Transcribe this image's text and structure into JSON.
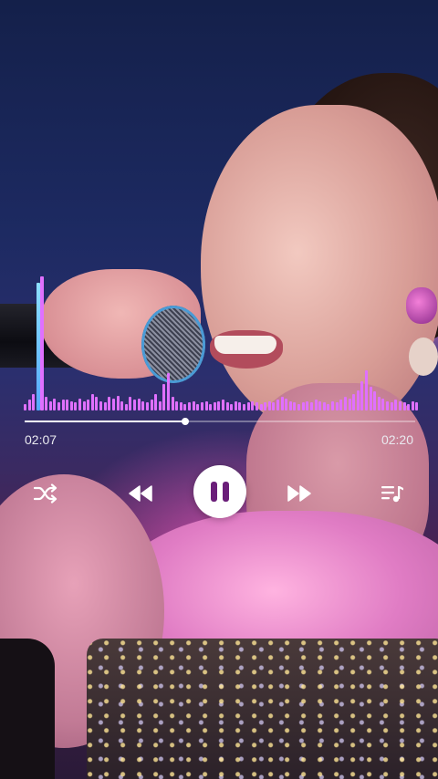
{
  "player": {
    "elapsed": "02:07",
    "duration": "02:20",
    "progress_fraction": 0.411,
    "state": "playing"
  },
  "controls": {
    "shuffle_icon": "shuffle-icon",
    "previous_icon": "rewind-icon",
    "pause_icon": "pause-icon",
    "next_icon": "fast-forward-icon",
    "queue_icon": "queue-music-icon"
  },
  "visualizer": {
    "color": "#e070ff",
    "accent_color": "#66b8ff",
    "levels": [
      0.05,
      0.08,
      0.12,
      0.95,
      1.0,
      0.1,
      0.07,
      0.09,
      0.06,
      0.08,
      0.08,
      0.07,
      0.06,
      0.09,
      0.07,
      0.08,
      0.12,
      0.1,
      0.07,
      0.06,
      0.1,
      0.09,
      0.11,
      0.07,
      0.05,
      0.1,
      0.08,
      0.09,
      0.07,
      0.06,
      0.08,
      0.12,
      0.07,
      0.2,
      0.28,
      0.1,
      0.07,
      0.06,
      0.05,
      0.06,
      0.07,
      0.05,
      0.06,
      0.07,
      0.05,
      0.06,
      0.07,
      0.08,
      0.06,
      0.05,
      0.07,
      0.06,
      0.05,
      0.06,
      0.07,
      0.06,
      0.05,
      0.06,
      0.07,
      0.06,
      0.08,
      0.1,
      0.09,
      0.07,
      0.06,
      0.05,
      0.06,
      0.07,
      0.06,
      0.08,
      0.07,
      0.06,
      0.05,
      0.07,
      0.06,
      0.08,
      0.1,
      0.09,
      0.12,
      0.15,
      0.22,
      0.3,
      0.18,
      0.14,
      0.1,
      0.09,
      0.07,
      0.06,
      0.08,
      0.07,
      0.06,
      0.05,
      0.07,
      0.06
    ]
  }
}
